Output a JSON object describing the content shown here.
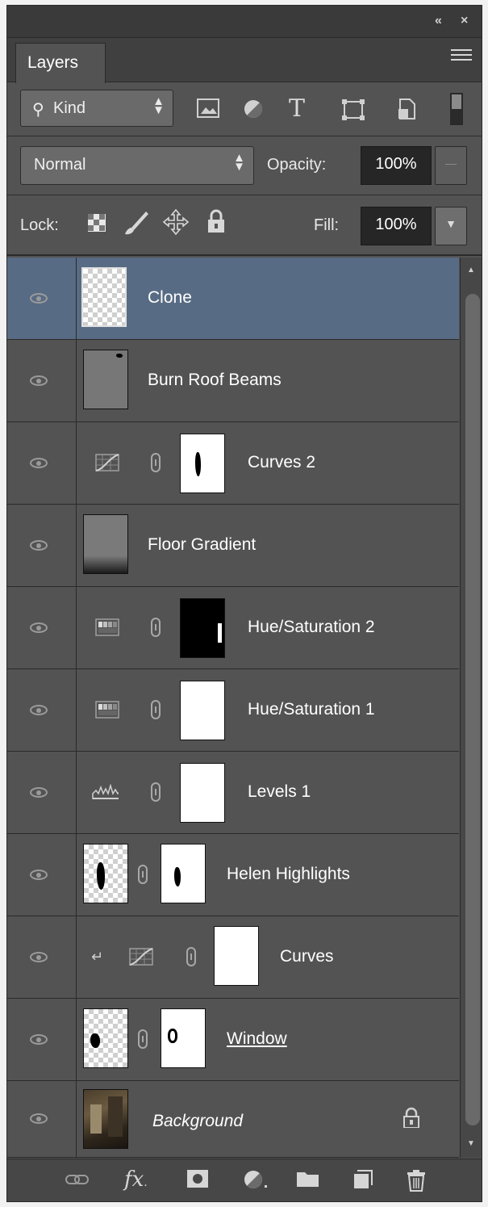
{
  "panel": {
    "tab_label": "Layers",
    "collapse_icon": "double-chevron-left-icon",
    "close_icon": "close-icon"
  },
  "filter": {
    "kind_label": "Kind",
    "icons": [
      "pixel-layer-filter-icon",
      "adjustment-layer-filter-icon",
      "type-layer-filter-icon",
      "shape-layer-filter-icon",
      "smart-object-filter-icon",
      "filter-toggle-icon"
    ],
    "type_filter_glyph": "T"
  },
  "blend": {
    "mode": "Normal",
    "opacity_label": "Opacity:",
    "opacity_value": "100%"
  },
  "lock": {
    "label": "Lock:",
    "fill_label": "Fill:",
    "fill_value": "100%"
  },
  "layers": [
    {
      "name": "Clone",
      "selected": true
    },
    {
      "name": "Burn Roof Beams"
    },
    {
      "name": "Curves 2"
    },
    {
      "name": "Floor Gradient"
    },
    {
      "name": "Hue/Saturation 2"
    },
    {
      "name": "Hue/Saturation 1"
    },
    {
      "name": "Levels 1"
    },
    {
      "name": "Helen Highlights"
    },
    {
      "name": "Curves"
    },
    {
      "name": "Window"
    },
    {
      "name": "Background",
      "locked": true
    }
  ],
  "footer": {
    "fx_label": "fx",
    "icons": [
      "link-layers-icon",
      "layer-style-icon",
      "add-mask-icon",
      "new-adjustment-icon",
      "new-group-icon",
      "new-layer-icon",
      "delete-icon"
    ]
  },
  "colors": {
    "panel_bg": "#535353",
    "selected_row": "#586b84",
    "field_dark": "#262626"
  }
}
